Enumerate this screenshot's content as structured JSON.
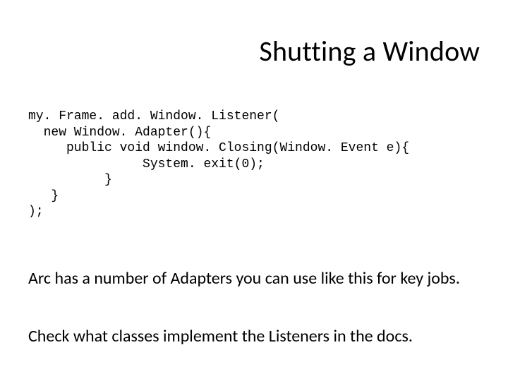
{
  "title": "Shutting a Window",
  "code": "my. Frame. add. Window. Listener(\n  new Window. Adapter(){\n     public void window. Closing(Window. Event e){\n               System. exit(0);\n          }\n   }\n);",
  "paragraph1": "Arc has a number of Adapters you can use like this for key jobs.",
  "paragraph2": "Check what classes implement the Listeners in the docs."
}
